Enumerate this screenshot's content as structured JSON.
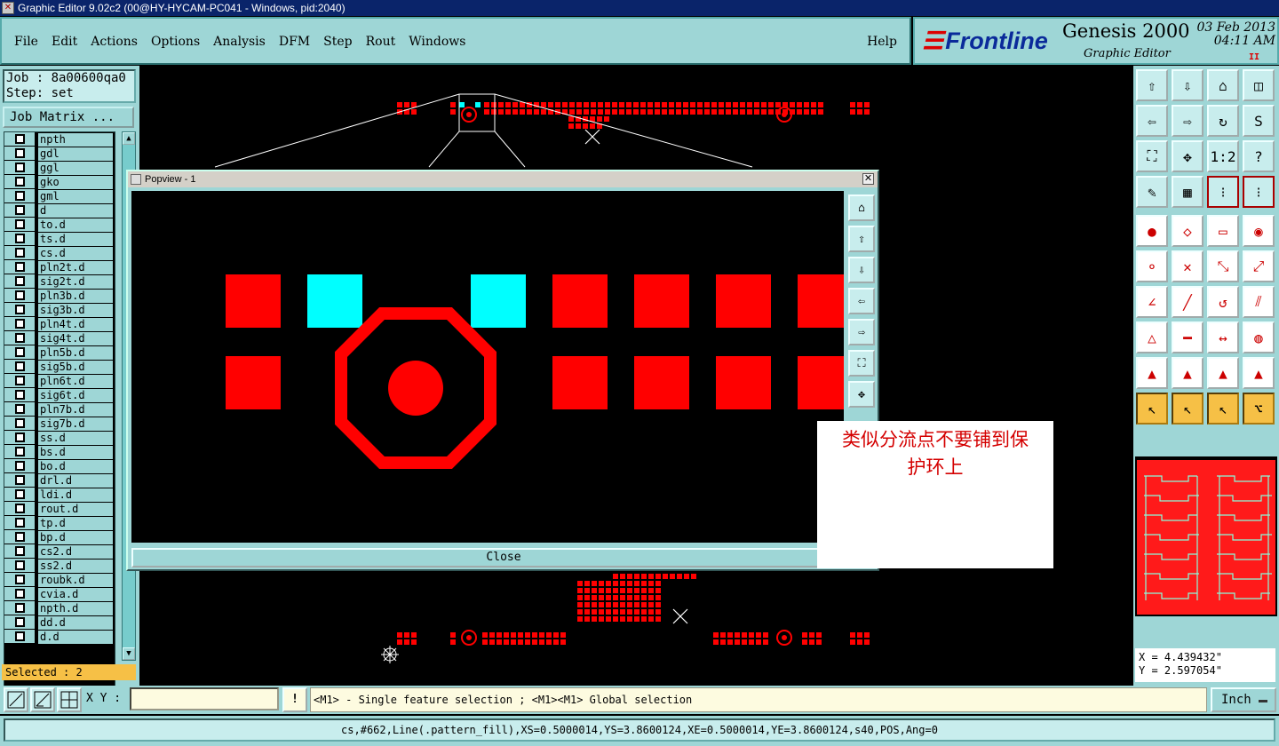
{
  "window": {
    "title": "Graphic Editor 9.02c2 (00@HY-HYCAM-PC041 - Windows, pid:2040)"
  },
  "menu": {
    "items": [
      "File",
      "Edit",
      "Actions",
      "Options",
      "Analysis",
      "DFM",
      "Step",
      "Rout",
      "Windows"
    ],
    "help": "Help"
  },
  "brand": {
    "logo": "Frontline",
    "product": "Genesis 2000",
    "subtitle": "Graphic Editor",
    "date": "03 Feb 2013",
    "time": "04:11 AM",
    "mark": "II"
  },
  "job": {
    "job_label": "Job : 8a00600qa0",
    "step_label": "Step: set",
    "matrix_button": "Job Matrix ...",
    "layers": [
      "npth",
      "gdl",
      "ggl",
      "gko",
      "gml",
      "d",
      "to.d",
      "ts.d",
      "cs.d",
      "pln2t.d",
      "sig2t.d",
      "pln3b.d",
      "sig3b.d",
      "pln4t.d",
      "sig4t.d",
      "pln5b.d",
      "sig5b.d",
      "pln6t.d",
      "sig6t.d",
      "pln7b.d",
      "sig7b.d",
      "ss.d",
      "bs.d",
      "bo.d",
      "drl.d",
      "ldi.d",
      "rout.d",
      "tp.d",
      "bp.d",
      "cs2.d",
      "ss2.d",
      "roubk.d",
      "cvia.d",
      "npth.d",
      "dd.d",
      "d.d"
    ],
    "selected": "Selected : 2"
  },
  "popview": {
    "title": "Popview - 1",
    "close_label": "Close"
  },
  "annotation": {
    "line1": "类似分流点不要铺到保",
    "line2": "护环上"
  },
  "coords": {
    "x": "X = 4.439432\"",
    "y": "Y = 2.597054\""
  },
  "command": {
    "xy_label": "X Y :",
    "xy_value": "",
    "message": "<M1> - Single feature selection ; <M1><M1> Global selection",
    "unit": "Inch"
  },
  "status": {
    "text": "cs,#662,Line(.pattern_fill),XS=0.5000014,YS=3.8600124,XE=0.5000014,YE=3.8600124,s40,POS,Ang=0"
  },
  "colors": {
    "ui_bg": "#9ed6d6",
    "copper": "#ff0000",
    "selected_feature": "#00ffff",
    "highlight": "#f6c046",
    "annotation_text": "#d40000"
  },
  "toolbar_icons": [
    "home-up-icon",
    "move-down-icon",
    "house-icon",
    "split-window-icon",
    "move-left-icon",
    "move-right-icon",
    "rotate-icon",
    "snake-icon",
    "zoom-fit-icon",
    "zoom-center-icon",
    "ratio-1-2-icon",
    "help-icon",
    "tools-icon",
    "grid-icon",
    "layer-compare-icon",
    "layer-compare-2-icon",
    "add-pad-icon",
    "shape-edit-icon",
    "ruler-icon",
    "circle-select-icon",
    "link-icon",
    "delete-icon",
    "resize-icon",
    "move-point-icon",
    "line-icon",
    "diagonal-line-icon",
    "arc-icon",
    "mirror-icon",
    "pad-align-icon",
    "minus-icon",
    "measure-icon",
    "touch-icon",
    "triangle-1-icon",
    "triangle-2-icon",
    "triangle-3-icon",
    "triangle-4-icon",
    "pointer-icon",
    "pointer-box-icon",
    "pointer-box-2-icon",
    "net-icon"
  ]
}
